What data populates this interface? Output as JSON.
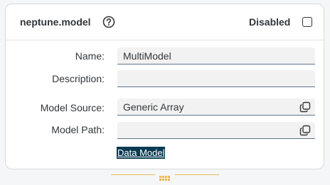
{
  "header": {
    "title": "neptune.model",
    "help_icon": "question-circle-icon",
    "disabled_label": "Disabled",
    "disabled_checked": false
  },
  "form": {
    "name": {
      "label": "Name:",
      "value": "MultiModel"
    },
    "description": {
      "label": "Description:",
      "value": ""
    },
    "model_source": {
      "label": "Model Source:",
      "value": "Generic Array",
      "icon": "value-help-icon"
    },
    "model_path": {
      "label": "Model Path:",
      "value": "",
      "icon": "value-help-icon"
    }
  },
  "link": {
    "label": "Data Model"
  },
  "colors": {
    "accent_gold": "#e7b85b",
    "field_border": "#5b738b",
    "text": "#32363a",
    "link_bg": "#0a3a52"
  },
  "resize_handle": {
    "icon": "grip-dots-icon"
  }
}
